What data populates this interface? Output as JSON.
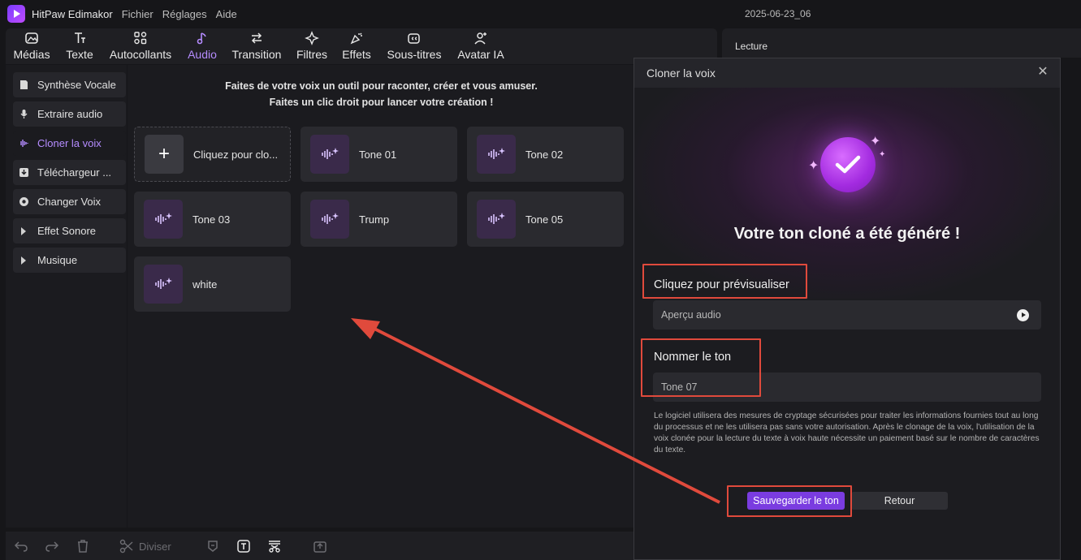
{
  "titlebar": {
    "app_name": "HitPaw Edimakor",
    "menu": [
      "Fichier",
      "Réglages",
      "Aide"
    ],
    "project": "2025-06-23_06"
  },
  "toolbar": {
    "tools": [
      {
        "label": "Médias",
        "icon": "media-icon"
      },
      {
        "label": "Texte",
        "icon": "text-icon"
      },
      {
        "label": "Autocollants",
        "icon": "sticker-icon"
      },
      {
        "label": "Audio",
        "icon": "audio-icon",
        "active": true
      },
      {
        "label": "Transition",
        "icon": "transition-icon"
      },
      {
        "label": "Filtres",
        "icon": "filter-icon"
      },
      {
        "label": "Effets",
        "icon": "effects-icon"
      },
      {
        "label": "Sous-titres",
        "icon": "subtitles-icon"
      },
      {
        "label": "Avatar IA",
        "icon": "avatar-icon"
      }
    ]
  },
  "preview": {
    "label": "Lecture"
  },
  "sidebar": {
    "items": [
      {
        "label": "Synthèse Vocale",
        "icon": "tts-icon"
      },
      {
        "label": "Extraire audio",
        "icon": "microphone-icon"
      },
      {
        "label": "Cloner la voix",
        "icon": "waveform-icon",
        "active": true
      },
      {
        "label": "Téléchargeur ...",
        "icon": "download-icon"
      },
      {
        "label": "Changer Voix",
        "icon": "voice-change-icon"
      },
      {
        "label": "Effet Sonore",
        "icon": "triangle-right-icon"
      },
      {
        "label": "Musique",
        "icon": "triangle-right-icon"
      }
    ]
  },
  "main": {
    "intro_line1": "Faites de votre voix un outil pour raconter, créer et vous amuser.",
    "intro_line2": "Faites un clic droit pour lancer votre création !",
    "add_card_label": "Cliquez pour clo...",
    "tones": [
      "Tone 01",
      "Tone 02",
      "Tone 03",
      "Trump",
      "Tone 05",
      "white"
    ]
  },
  "bottombar": {
    "split_label": "Diviser"
  },
  "dialog": {
    "title": "Cloner la voix",
    "heading": "Votre ton cloné a été généré !",
    "preview_label": "Cliquez pour prévisualiser",
    "preview_field": "Aperçu audio",
    "name_label": "Nommer le ton",
    "name_value": "Tone 07",
    "notice": "Le logiciel utilisera des mesures de cryptage sécurisées pour traiter les informations fournies tout au long du processus et ne les utilisera pas sans votre autorisation. Après le clonage de la voix, l'utilisation de la voix clonée pour la lecture du texte à voix haute nécessite un paiement basé sur le nombre de caractères du texte.",
    "save_button": "Sauvegarder le ton",
    "back_button": "Retour"
  },
  "colors": {
    "accent": "#b58cff",
    "primary_button": "#7a3ce0",
    "annotation": "#e04a3c"
  }
}
